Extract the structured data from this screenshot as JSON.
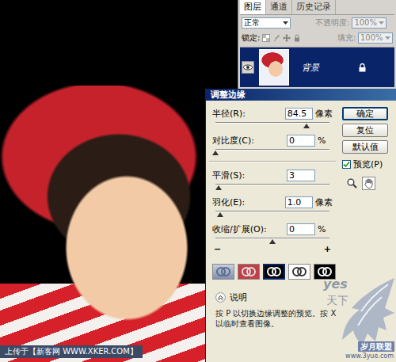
{
  "layers_panel": {
    "tabs": [
      {
        "label": "图层",
        "selected": true
      },
      {
        "label": "通道",
        "selected": false
      },
      {
        "label": "历史记录",
        "selected": false
      }
    ],
    "blend_mode": "正常",
    "opacity_label": "不透明度:",
    "opacity": "100%",
    "opacity_disabled": true,
    "lock_label": "锁定:",
    "fill_label": "填充:",
    "fill": "100%",
    "fill_disabled": true,
    "layers": [
      {
        "name": "背景",
        "visible": true,
        "locked": true,
        "selected": true
      }
    ]
  },
  "dialog": {
    "title": "调整边缘",
    "slider_groups": [
      [
        {
          "label": "半径(R):",
          "value": "84.5",
          "unit": "像素",
          "level": 0.8
        },
        {
          "label": "对比度(C):",
          "value": "0",
          "unit": "%",
          "level": 0
        }
      ],
      [
        {
          "label": "平滑(S):",
          "value": "3",
          "level": 0.03
        },
        {
          "label": "羽化(E):",
          "value": "1.0",
          "unit": "像素",
          "level": 0.04
        },
        {
          "label": "收缩/扩展(O):",
          "value": "0",
          "unit": "%",
          "level": 0.5,
          "marks": [
            "−",
            "+"
          ]
        }
      ]
    ],
    "buttons": [
      {
        "label": "确定",
        "default": true
      },
      {
        "label": "复位",
        "default": false
      },
      {
        "label": "默认值",
        "default": false
      }
    ],
    "preview": {
      "label": "预览(P)",
      "checked": true
    },
    "view_modes": [
      {
        "kind": "standard",
        "selected": false
      },
      {
        "kind": "quickmask",
        "selected": false
      },
      {
        "kind": "onblack",
        "selected": true
      },
      {
        "kind": "onwhite",
        "selected": false
      },
      {
        "kind": "mask",
        "selected": false
      }
    ],
    "description_label": "说明",
    "description_expanded": true,
    "description": [
      "按 P 以切换边缘调整的预览。按 X",
      "以临时查看图像。"
    ]
  },
  "footer_caption": "上传于【新客网 WWW.XKER.COM】",
  "watermark": {
    "brand": "yes",
    "brand_cn": "天下",
    "badge": "岁月联盟",
    "url": "www.3yue.com"
  }
}
